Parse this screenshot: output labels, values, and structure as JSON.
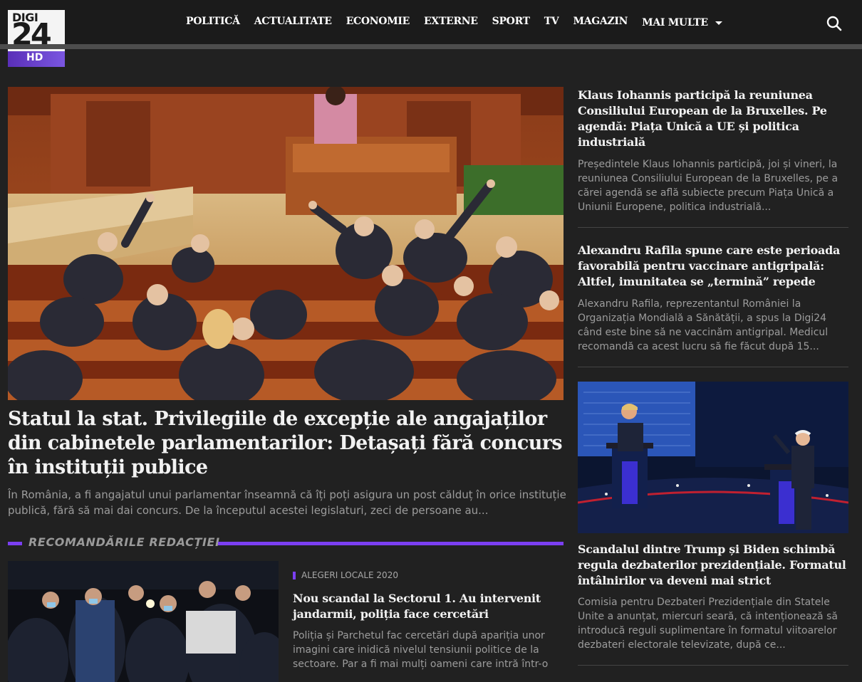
{
  "logo": {
    "brand": "DIGI",
    "number": "24",
    "suffix": "HD"
  },
  "nav": {
    "items": [
      "POLITICĂ",
      "ACTUALITATE",
      "ECONOMIE",
      "EXTERNE",
      "SPORT",
      "TV",
      "MAGAZIN"
    ],
    "more_label": "MAI MULTE"
  },
  "main_article": {
    "title": "Statul la stat. Privilegiile de excepție ale angajaților din cabinetele parlamentarilor: Detașați fără concurs în instituții publice",
    "description": "În România, a fi angajatul unui parlamentar înseamnă că îți poți asigura un post călduț în orice instituție publică, fără să mai dai concurs. De la începutul acestei legislaturi, zeci de persoane au..."
  },
  "recommendations": {
    "heading": "RECOMANDĂRILE REDACȚIEI",
    "article": {
      "tag": "ALEGERI LOCALE 2020",
      "title": "Nou scandal la Sectorul 1. Au intervenit jandarmii, poliția face cercetări",
      "description": "Poliția și Parchetul fac cercetări după apariția unor imagini care inidică nivelul tensiunii politice de la sectoare. Par a fi mai mulți oameni care intră într-o"
    }
  },
  "sidebar": {
    "articles": [
      {
        "title": "Klaus Iohannis participă la reuniunea Consiliului European de la Bruxelles. Pe agendă: Piața Unică a UE și politica industrială",
        "description": "Președintele Klaus Iohannis participă, joi și vineri, la reuniunea Consiliului European de la Bruxelles, pe a cărei agendă se află subiecte precum Piața Unică a Uniunii Europene, politica industrială..."
      },
      {
        "title": "Alexandru Rafila spune care este perioada favorabilă pentru vaccinare antigripală: Altfel, imunitatea se „termină” repede",
        "description": "Alexandru Rafila, reprezentantul României la Organizația Mondială a Sănătății, a spus la Digi24 când este bine să ne vaccinăm antigripal. Medicul recomandă ca acest lucru să fie făcut după 15..."
      },
      {
        "title": "Scandalul dintre Trump și Biden schimbă regula dezbaterilor prezidențiale. Formatul întâlnirilor va deveni mai strict",
        "description": "Comisia pentru Dezbateri Prezidențiale din Statele Unite a anunțat, miercuri seară, că intenționează să introducă reguli suplimentare în formatul viitoarelor dezbateri electorale televizate, după ce..."
      }
    ]
  },
  "colors": {
    "accent": "#7b3ff2",
    "background": "#212121",
    "header": "#1b1b1b"
  },
  "icons": {
    "search": "search-icon",
    "dropdown": "chevron-down-icon"
  }
}
